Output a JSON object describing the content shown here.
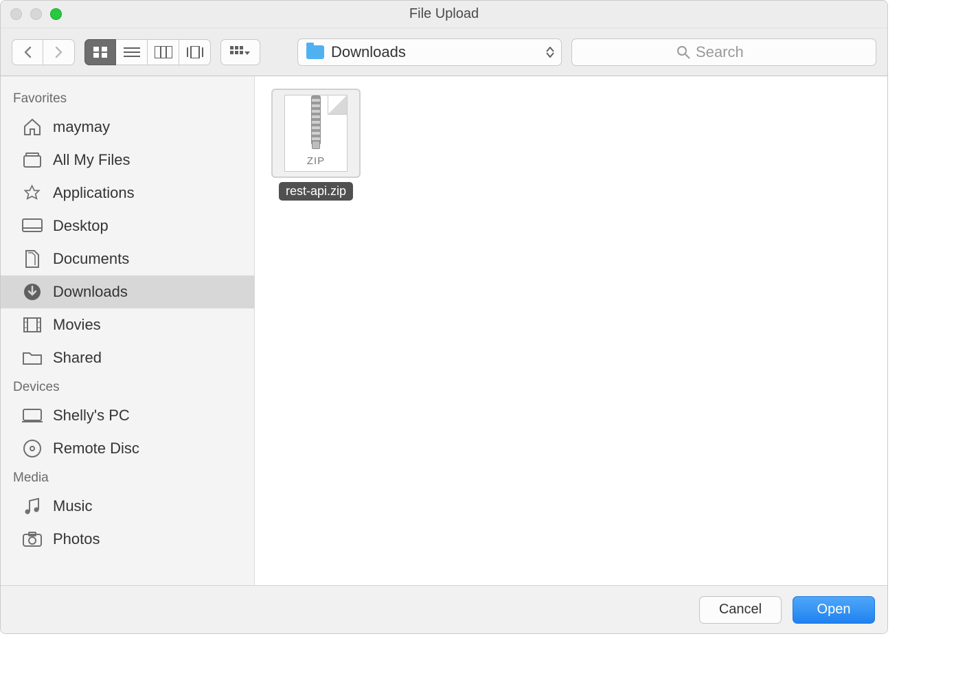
{
  "window": {
    "title": "File Upload"
  },
  "toolbar": {
    "currentFolder": "Downloads",
    "searchPlaceholder": "Search"
  },
  "sidebar": {
    "sections": [
      {
        "title": "Favorites",
        "items": [
          {
            "icon": "home",
            "label": "maymay",
            "selected": false
          },
          {
            "icon": "allmyfiles",
            "label": "All My Files",
            "selected": false
          },
          {
            "icon": "apps",
            "label": "Applications",
            "selected": false
          },
          {
            "icon": "desktop",
            "label": "Desktop",
            "selected": false
          },
          {
            "icon": "documents",
            "label": "Documents",
            "selected": false
          },
          {
            "icon": "downloads",
            "label": "Downloads",
            "selected": true
          },
          {
            "icon": "movies",
            "label": "Movies",
            "selected": false
          },
          {
            "icon": "folder",
            "label": "Shared",
            "selected": false
          }
        ]
      },
      {
        "title": "Devices",
        "items": [
          {
            "icon": "computer",
            "label": "Shelly's PC",
            "selected": false
          },
          {
            "icon": "disc",
            "label": "Remote Disc",
            "selected": false
          }
        ]
      },
      {
        "title": "Media",
        "items": [
          {
            "icon": "music",
            "label": "Music",
            "selected": false
          },
          {
            "icon": "photos",
            "label": "Photos",
            "selected": false
          }
        ]
      }
    ]
  },
  "content": {
    "files": [
      {
        "name": "rest-api.zip",
        "type": "zip",
        "formatLabel": "ZIP",
        "selected": true
      }
    ]
  },
  "footer": {
    "cancel": "Cancel",
    "open": "Open"
  }
}
